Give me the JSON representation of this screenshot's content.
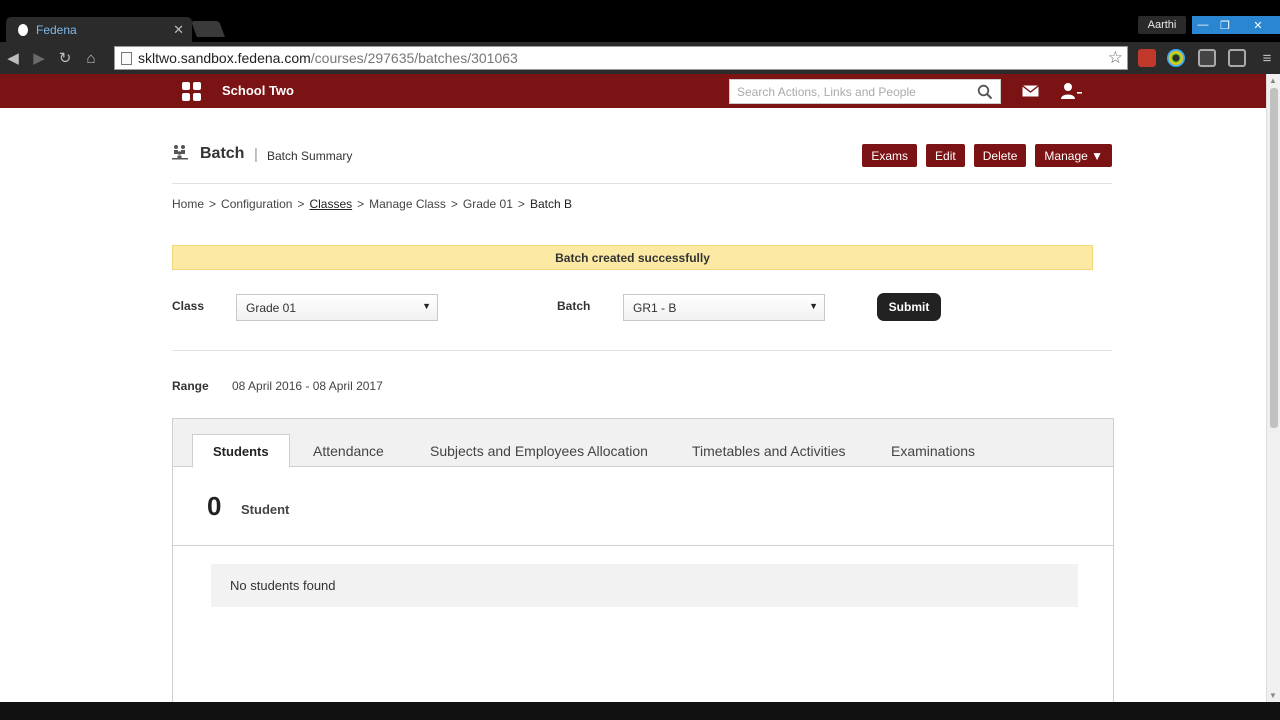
{
  "browser": {
    "tab_title": "Fedena",
    "profile_name": "Aarthi",
    "url_host": "skltwo.sandbox.fedena.com",
    "url_path": "/courses/297635/batches/301063"
  },
  "appbar": {
    "school_name": "School Two",
    "search_placeholder": "Search Actions, Links and People",
    "brand_color": "#7b1213"
  },
  "header": {
    "title": "Batch",
    "separator": "|",
    "subtitle": "Batch Summary",
    "actions": [
      "Exams",
      "Edit",
      "Delete",
      "Manage ▼"
    ]
  },
  "breadcrumb": {
    "items": [
      "Home",
      "Configuration",
      "Classes",
      "Manage Class",
      "Grade 01",
      "Batch B"
    ],
    "separator": ">"
  },
  "flash": {
    "message": "Batch created successfully"
  },
  "form": {
    "class_label": "Class",
    "class_value": "Grade 01",
    "batch_label": "Batch",
    "batch_value": "GR1 - B",
    "submit_label": "Submit"
  },
  "range": {
    "label": "Range",
    "value": "08 April 2016 - 08 April 2017"
  },
  "tabs": [
    "Students",
    "Attendance",
    "Subjects and Employees Allocation",
    "Timetables and Activities",
    "Examinations"
  ],
  "students": {
    "count": "0",
    "count_label": "Student",
    "empty_message": "No students found"
  }
}
